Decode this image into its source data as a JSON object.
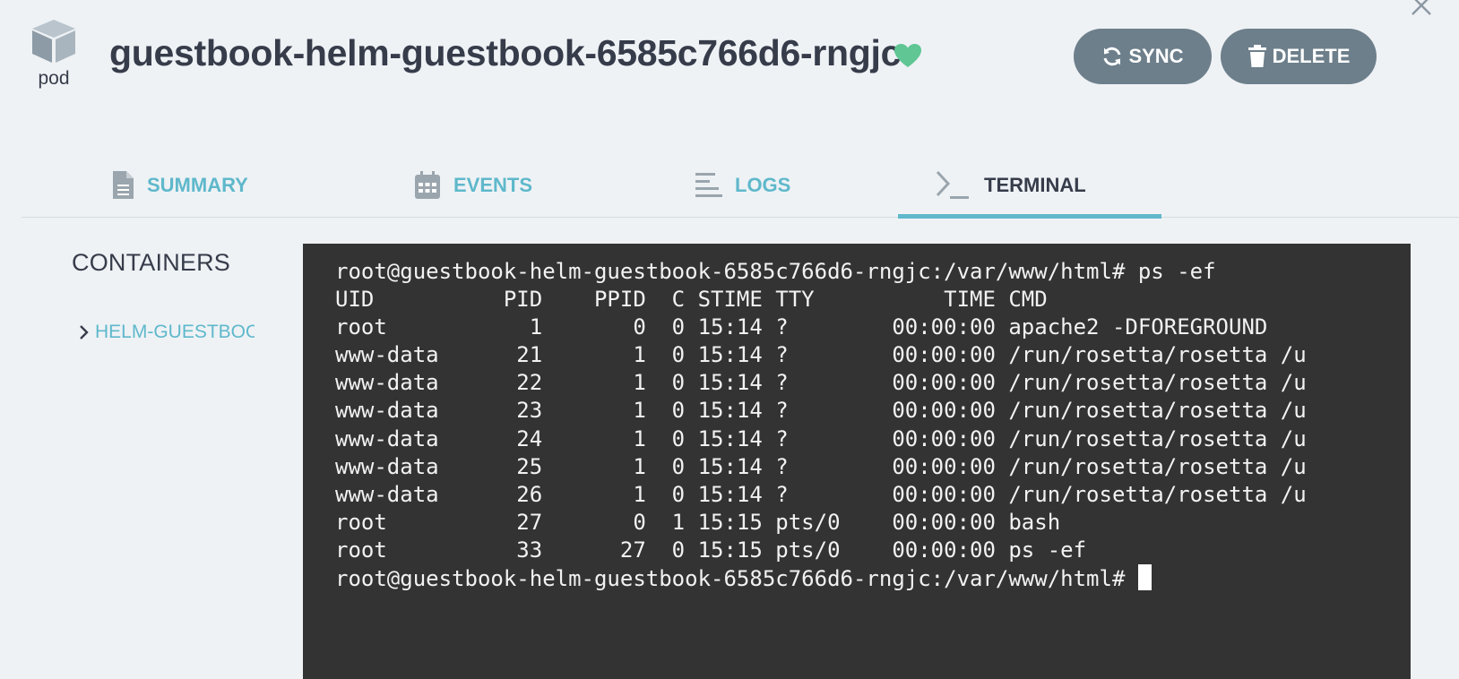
{
  "header": {
    "kind_label": "pod",
    "title": "guestbook-helm-guestbook-6585c766d6-rngjc",
    "health_status": "Healthy",
    "sync_label": "SYNC",
    "delete_label": "DELETE"
  },
  "tabs": [
    {
      "label": "SUMMARY",
      "icon": "file-text-icon",
      "active": false
    },
    {
      "label": "EVENTS",
      "icon": "calendar-icon",
      "active": false
    },
    {
      "label": "LOGS",
      "icon": "logs-icon",
      "active": false
    },
    {
      "label": "TERMINAL",
      "icon": "terminal-icon",
      "active": true
    }
  ],
  "sidebar": {
    "heading": "CONTAINERS",
    "containers": [
      {
        "name": "HELM-GUESTBOOK"
      }
    ]
  },
  "terminal": {
    "lines": [
      "root@guestbook-helm-guestbook-6585c766d6-rngjc:/var/www/html# ps -ef",
      "UID          PID    PPID  C STIME TTY          TIME CMD",
      "root           1       0  0 15:14 ?        00:00:00 apache2 -DFOREGROUND",
      "www-data      21       1  0 15:14 ?        00:00:00 /run/rosetta/rosetta /u",
      "www-data      22       1  0 15:14 ?        00:00:00 /run/rosetta/rosetta /u",
      "www-data      23       1  0 15:14 ?        00:00:00 /run/rosetta/rosetta /u",
      "www-data      24       1  0 15:14 ?        00:00:00 /run/rosetta/rosetta /u",
      "www-data      25       1  0 15:14 ?        00:00:00 /run/rosetta/rosetta /u",
      "www-data      26       1  0 15:14 ?        00:00:00 /run/rosetta/rosetta /u",
      "root          27       0  1 15:15 pts/0    00:00:00 bash",
      "root          33      27  0 15:15 pts/0    00:00:00 ps -ef"
    ],
    "prompt": "root@guestbook-helm-guestbook-6585c766d6-rngjc:/var/www/html# "
  },
  "colors": {
    "accent": "#5fb8cb",
    "health_green": "#5fc694",
    "button_bg": "#6d7f8b",
    "terminal_bg": "#333333",
    "page_bg": "#eef2f5"
  }
}
